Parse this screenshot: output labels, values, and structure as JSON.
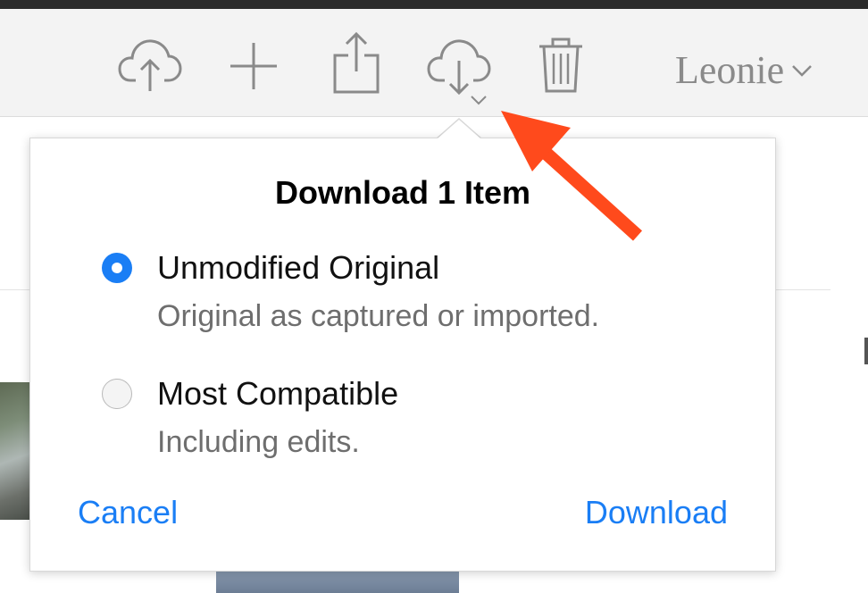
{
  "toolbar": {
    "icons": [
      "cloud-upload-icon",
      "plus-icon",
      "share-icon",
      "cloud-download-icon",
      "trash-icon"
    ],
    "user_name": "Leonie",
    "user_menu_icon": "chevron-down-icon"
  },
  "dialog": {
    "title": "Download 1 Item",
    "options": [
      {
        "label": "Unmodified Original",
        "description": "Original as captured or imported.",
        "selected": true
      },
      {
        "label": "Most Compatible",
        "description": "Including edits.",
        "selected": false
      }
    ],
    "cancel_label": "Cancel",
    "download_label": "Download"
  },
  "colors": {
    "accent": "#1a7ef5",
    "annotation_arrow": "#ff4a1c",
    "toolbar_bg": "#f3f3f3",
    "icon_gray": "#8a8a8a"
  },
  "annotation": {
    "type": "arrow",
    "points_to": "cloud-download-icon"
  }
}
